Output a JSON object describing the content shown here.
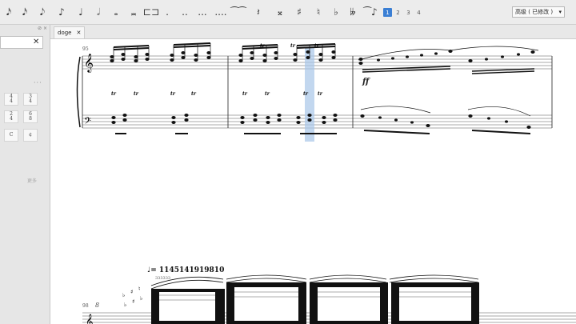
{
  "toolbar": {
    "note_values": [
      "𝅘𝅥𝅯",
      "𝅘𝅥𝅯",
      "𝅘𝅥𝅮",
      "♪",
      "♩",
      "𝅗𝅥",
      "𝅝",
      "𝅜",
      "."
    ],
    "accidentals": [
      "𝄪",
      "♯",
      "♮",
      "♭",
      "𝄫",
      "♮"
    ],
    "voices": [
      "1",
      "2",
      "3",
      "4"
    ],
    "workspace": "高级 ( 已修改 )"
  },
  "palette": {
    "time_signatures": [
      [
        "4",
        "4"
      ],
      [
        "3",
        "4"
      ],
      [
        "2",
        "4"
      ],
      [
        "6",
        "8"
      ],
      [
        "C",
        ""
      ],
      [
        "¢",
        ""
      ]
    ],
    "more_label": "更多"
  },
  "tab": {
    "name": "doge"
  },
  "score": {
    "measure_number_top": "95",
    "measure_number_bottom": "98",
    "tempo_mark": "♩= 1145141919810",
    "tuplet_label": "333333",
    "dynamic": "ff",
    "ottava": "8"
  },
  "colors": {
    "accent": "#3b7fd4",
    "selection": "#a8c6e8"
  }
}
